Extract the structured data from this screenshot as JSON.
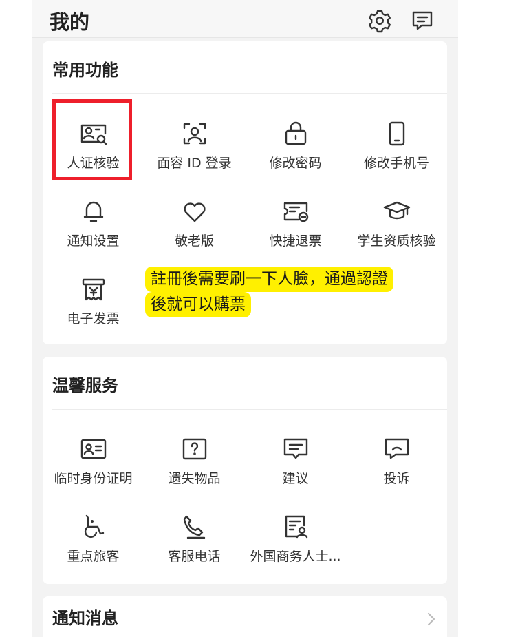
{
  "header": {
    "title": "我的",
    "icons": [
      "settings-gear-icon",
      "message-icon"
    ]
  },
  "common_functions": {
    "title": "常用功能",
    "items": [
      {
        "label": "人证核验",
        "icon": "id-card-search-icon",
        "highlighted": true
      },
      {
        "label": "面容 ID 登录",
        "icon": "face-scan-icon"
      },
      {
        "label": "修改密码",
        "icon": "lock-icon"
      },
      {
        "label": "修改手机号",
        "icon": "phone-icon"
      },
      {
        "label": "通知设置",
        "icon": "bell-icon"
      },
      {
        "label": "敬老版",
        "icon": "heart-icon"
      },
      {
        "label": "快捷退票",
        "icon": "ticket-refund-icon"
      },
      {
        "label": "学生资质核验",
        "icon": "graduation-cap-icon"
      },
      {
        "label": "电子发票",
        "icon": "invoice-icon"
      }
    ]
  },
  "annotation": {
    "line1": "註冊後需要刷一下人臉，通過認證",
    "line2": "後就可以購票",
    "highlight_color": "#fff000",
    "box_color": "#ee1f2b"
  },
  "warm_services": {
    "title": "温馨服务",
    "items": [
      {
        "label": "临时身份证明",
        "icon": "id-card-icon"
      },
      {
        "label": "遗失物品",
        "icon": "question-box-icon"
      },
      {
        "label": "建议",
        "icon": "suggestion-icon"
      },
      {
        "label": "投诉",
        "icon": "complaint-icon"
      },
      {
        "label": "重点旅客",
        "icon": "wheelchair-icon"
      },
      {
        "label": "客服电话",
        "icon": "phone-call-icon"
      },
      {
        "label": "外国商务人士...",
        "icon": "certificate-icon"
      }
    ]
  },
  "notifications": {
    "title": "通知消息",
    "icon": "chevron-right-icon"
  }
}
